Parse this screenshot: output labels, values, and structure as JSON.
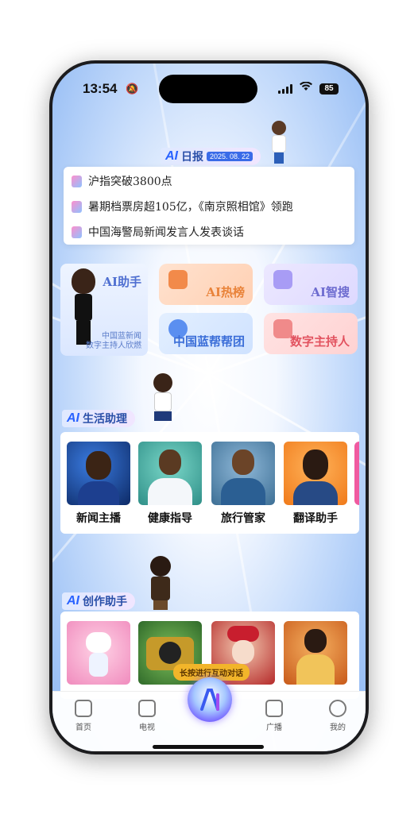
{
  "status_bar": {
    "time": "13:54",
    "battery": "85"
  },
  "ai_daily": {
    "logo": "AI",
    "title": "日报",
    "date": "2025. 08. 22"
  },
  "news": [
    {
      "text": "沪指突破3800点"
    },
    {
      "text": "暑期档票房超105亿，《南京照相馆》领跑"
    },
    {
      "text": "中国海警局新闻发言人发表谈话"
    }
  ],
  "assistant": {
    "title": "AI助手",
    "subtitle_line1": "中国蓝新闻",
    "subtitle_line2": "数字主持人欣燃"
  },
  "tiles": [
    {
      "label": "AI热榜",
      "color": "#e9833a"
    },
    {
      "label": "AI智搜",
      "color": "#6e6cd0"
    },
    {
      "label": "中国蓝帮帮团",
      "color": "#3b6ed8"
    },
    {
      "label": "数字主持人",
      "color": "#e2525f"
    }
  ],
  "life_section": {
    "logo": "AI",
    "title": "生活助理",
    "items": [
      {
        "label": "新闻主播"
      },
      {
        "label": "健康指导"
      },
      {
        "label": "旅行管家"
      },
      {
        "label": "翻译助手"
      }
    ]
  },
  "create_section": {
    "logo": "AI",
    "title": "创作助手"
  },
  "hint": "长按进行互动对话",
  "nav": [
    {
      "label": "首页"
    },
    {
      "label": "电视"
    },
    {
      "label": "广播"
    },
    {
      "label": "我的"
    }
  ]
}
